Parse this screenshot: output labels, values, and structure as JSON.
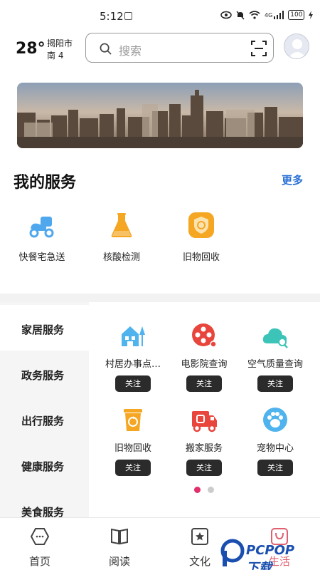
{
  "status_bar": {
    "time": "5:12",
    "network": "4G",
    "battery": "100"
  },
  "header": {
    "temperature": "28°",
    "city": "揭阳市",
    "wind": "南 4",
    "search_placeholder": "搜索"
  },
  "my_services": {
    "title": "我的服务",
    "more": "更多",
    "items": [
      {
        "label": "快餐宅急送",
        "icon": "scooter-icon"
      },
      {
        "label": "核酸检测",
        "icon": "flask-icon"
      },
      {
        "label": "旧物回收",
        "icon": "recycle-shield-icon"
      }
    ]
  },
  "categories": {
    "items": [
      {
        "label": "家居服务",
        "active": true
      },
      {
        "label": "政务服务",
        "active": false
      },
      {
        "label": "出行服务",
        "active": false
      },
      {
        "label": "健康服务",
        "active": false
      },
      {
        "label": "美食服务",
        "active": false
      }
    ],
    "grid": [
      {
        "label": "村居办事点…",
        "icon": "house-tree-icon",
        "button": "关注"
      },
      {
        "label": "电影院查询",
        "icon": "film-reel-icon",
        "button": "关注"
      },
      {
        "label": "空气质量查询",
        "icon": "cloud-search-icon",
        "button": "关注"
      },
      {
        "label": "旧物回收",
        "icon": "recycle-bin-icon",
        "button": "关注"
      },
      {
        "label": "搬家服务",
        "icon": "moving-truck-icon",
        "button": "关注"
      },
      {
        "label": "宠物中心",
        "icon": "paw-icon",
        "button": "关注"
      }
    ],
    "pagination": {
      "pages": 2,
      "current": 1
    }
  },
  "bottom_nav": {
    "items": [
      {
        "label": "首页",
        "icon": "home-icon"
      },
      {
        "label": "阅读",
        "icon": "book-icon"
      },
      {
        "label": "文化",
        "icon": "star-frame-icon"
      },
      {
        "label": "生活",
        "icon": "bag-icon"
      }
    ],
    "active": "生活"
  },
  "watermark": {
    "text": "PCPOP下载"
  },
  "colors": {
    "accent_blue": "#2a6fd6",
    "orange": "#f5a623",
    "red": "#e8453c",
    "teal": "#3cc4b8",
    "sky": "#4fb3ee",
    "dot_active": "#e0306a",
    "dot_inactive": "#cccccc"
  }
}
